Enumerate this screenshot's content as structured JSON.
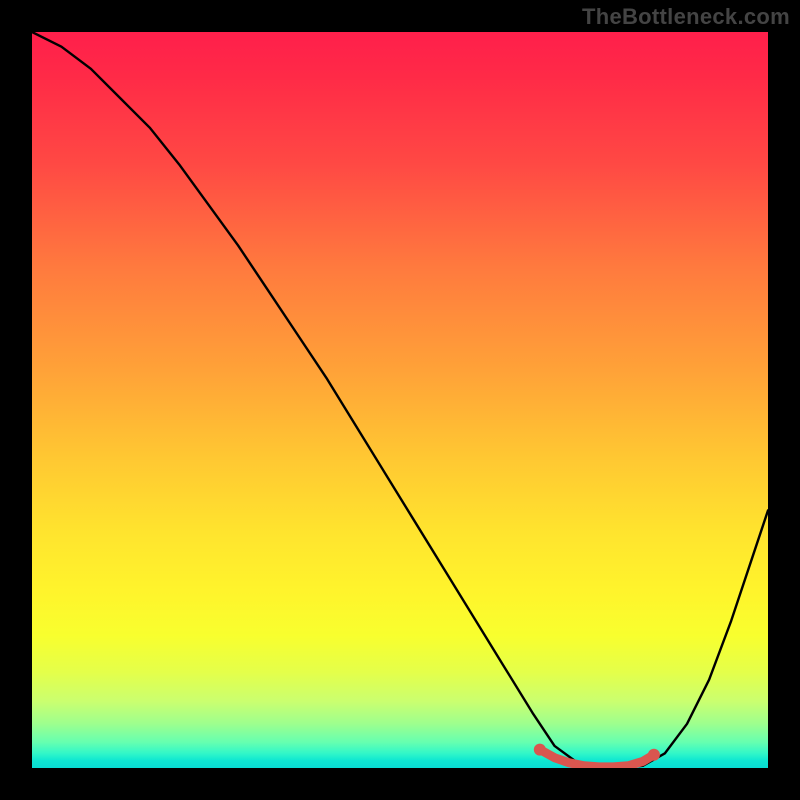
{
  "watermark": "TheBottleneck.com",
  "chart_data": {
    "type": "line",
    "title": "",
    "xlabel": "",
    "ylabel": "",
    "xlim": [
      0,
      100
    ],
    "ylim": [
      0,
      100
    ],
    "legend": false,
    "grid": false,
    "background": "red-yellow-green vertical gradient (bottleneck heatmap)",
    "series": [
      {
        "name": "bottleneck-curve",
        "color": "#000000",
        "x": [
          0,
          4,
          8,
          12,
          16,
          20,
          24,
          28,
          32,
          36,
          40,
          44,
          48,
          52,
          56,
          60,
          64,
          68,
          71,
          74,
          77,
          80,
          83,
          86,
          89,
          92,
          95,
          98,
          100
        ],
        "values": [
          100,
          98,
          95,
          91,
          87,
          82,
          76.5,
          71,
          65,
          59,
          53,
          46.5,
          40,
          33.5,
          27,
          20.5,
          14,
          7.5,
          3,
          0.8,
          0,
          0,
          0.3,
          2,
          6,
          12,
          20,
          29,
          35
        ]
      },
      {
        "name": "optimal-range-marker",
        "color": "#d9564f",
        "x": [
          69,
          71,
          73,
          75,
          77,
          79,
          81,
          83,
          84.5
        ],
        "values": [
          2.5,
          1.4,
          0.7,
          0.3,
          0.15,
          0.15,
          0.3,
          0.9,
          1.8
        ]
      }
    ],
    "annotations": []
  },
  "colors": {
    "plot_bg_top": "#ff1f4b",
    "plot_bg_bottom": "#09dcd3",
    "curve": "#000000",
    "marker": "#d9564f",
    "frame": "#000000"
  }
}
